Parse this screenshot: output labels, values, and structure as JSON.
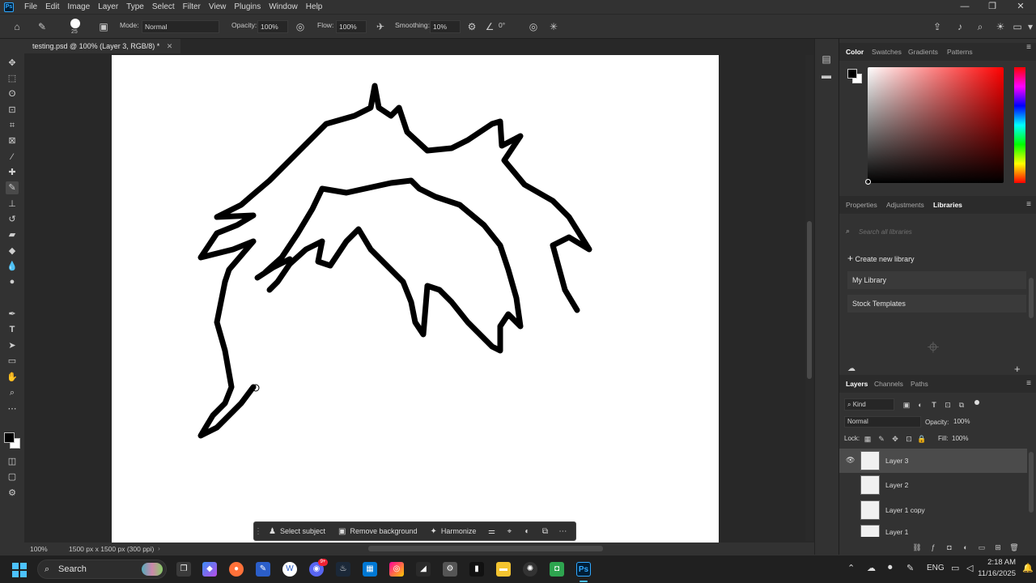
{
  "app": {
    "menu": [
      "File",
      "Edit",
      "Image",
      "Layer",
      "Type",
      "Select",
      "Filter",
      "View",
      "Plugins",
      "Window",
      "Help"
    ],
    "logo_text": "Ps"
  },
  "options_bar": {
    "brush_size": "25",
    "mode_label": "Mode:",
    "mode_value": "Normal",
    "opacity_label": "Opacity:",
    "opacity_value": "100%",
    "flow_label": "Flow:",
    "flow_value": "100%",
    "smoothing_label": "Smoothing:",
    "smoothing_value": "10%",
    "angle_value": "0°"
  },
  "document": {
    "tab_title": "testing.psd @ 100% (Layer 3, RGB/8) *",
    "zoom": "100%",
    "size_info": "1500 px x 1500 px (300 ppi)"
  },
  "context_bar": {
    "select_subject": "Select subject",
    "remove_background": "Remove background",
    "harmonize": "Harmonize"
  },
  "color_panel": {
    "tabs": [
      "Color",
      "Swatches",
      "Gradients",
      "Patterns"
    ],
    "active_tab": "Color",
    "hue_color": "#ff0000",
    "foreground": "#000000",
    "background": "#ffffff"
  },
  "libraries_panel": {
    "tabs": [
      "Properties",
      "Adjustments",
      "Libraries"
    ],
    "active_tab": "Libraries",
    "search_placeholder": "Search all libraries",
    "create_label": "Create new library",
    "libraries": [
      "My Library",
      "Stock Templates"
    ]
  },
  "layers_panel": {
    "tabs": [
      "Layers",
      "Channels",
      "Paths"
    ],
    "active_tab": "Layers",
    "filter_kind": "Kind",
    "blend_mode": "Normal",
    "opacity_label": "Opacity:",
    "opacity_value": "100%",
    "lock_label": "Lock:",
    "fill_label": "Fill:",
    "fill_value": "100%",
    "layers": [
      {
        "name": "Layer 3",
        "visible": true,
        "selected": true
      },
      {
        "name": "Layer 2",
        "visible": false,
        "selected": false
      },
      {
        "name": "Layer 1 copy",
        "visible": false,
        "selected": false
      },
      {
        "name": "Layer 1",
        "visible": false,
        "selected": false
      }
    ]
  },
  "taskbar": {
    "search_label": "Search",
    "language": "ENG",
    "time": "2:18 AM",
    "date": "11/16/2025",
    "discord_badge": "9+"
  }
}
